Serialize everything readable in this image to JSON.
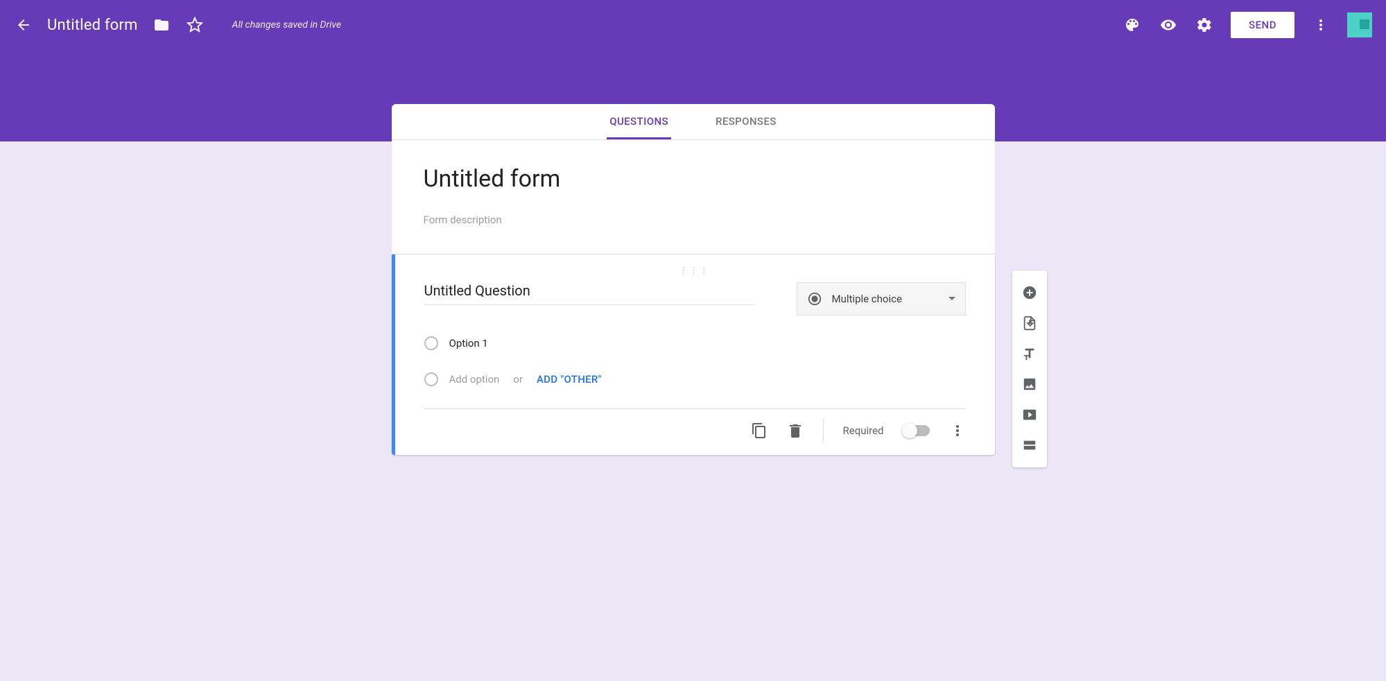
{
  "header": {
    "title": "Untitled form",
    "saved_text": "All changes saved in Drive",
    "send_label": "SEND"
  },
  "tabs": {
    "questions": "QUESTIONS",
    "responses": "RESPONSES"
  },
  "form": {
    "title": "Untitled form",
    "description_placeholder": "Form description"
  },
  "question": {
    "title": "Untitled Question",
    "type_label": "Multiple choice",
    "option1": "Option 1",
    "add_option": "Add option",
    "or": "or",
    "add_other": "ADD \"OTHER\"",
    "required_label": "Required"
  }
}
